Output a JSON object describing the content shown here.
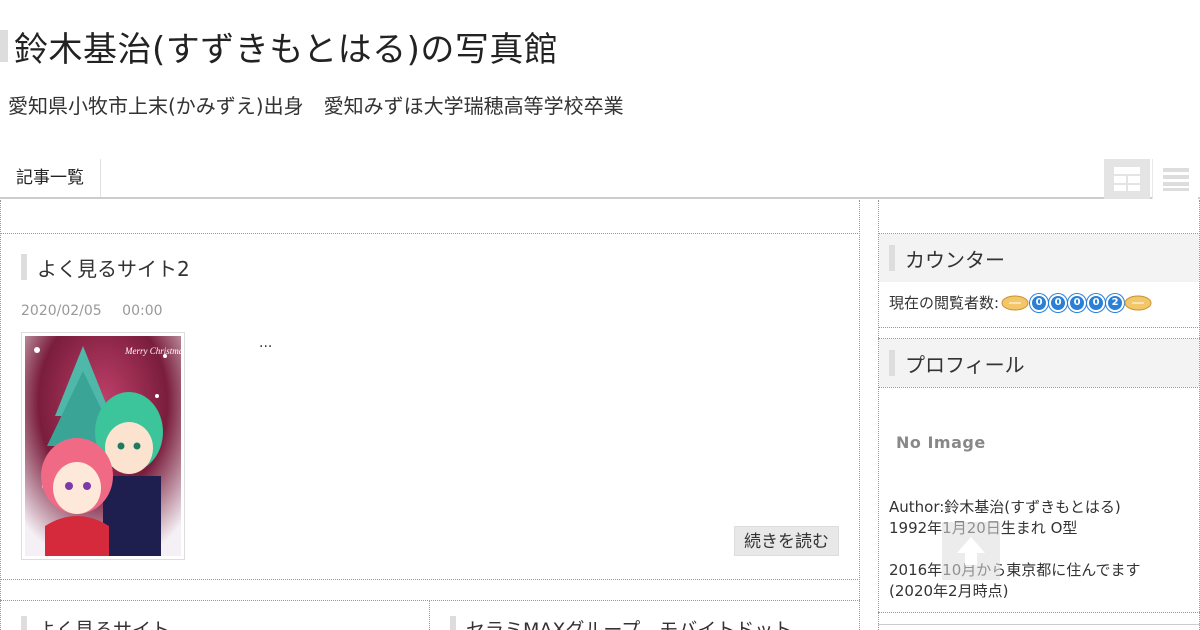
{
  "header": {
    "site_title": "鈴木基治(すずきもとはる)の写真館",
    "site_subtitle": "愛知県小牧市上末(かみずえ)出身　愛知みずほ大学瑞穂高等学校卒業"
  },
  "nav": {
    "items": [
      {
        "label": "記事一覧"
      }
    ],
    "view_grid_icon": "grid-view-icon",
    "view_list_icon": "list-view-icon"
  },
  "main": {
    "post": {
      "title": "よく見るサイト2",
      "date": "2020/02/05",
      "time": "00:00",
      "excerpt": "...",
      "thumbnail_caption": "Merry Christmas",
      "read_more": "続きを読む"
    },
    "next_posts": [
      {
        "title": "よく見るサイト"
      },
      {
        "title": "セラミMAXグループ　モバイトドット"
      }
    ]
  },
  "sidebar": {
    "counter": {
      "title": "カウンター",
      "label": "現在の閲覧者数:",
      "digits": [
        "0",
        "0",
        "0",
        "0",
        "2"
      ]
    },
    "profile": {
      "title": "プロフィール",
      "no_image": "No Image",
      "lines": [
        "Author:鈴木基治(すずきもとはる)",
        "1992年1月20日生まれ O型",
        "",
        "2016年10月から東京都に住んでます",
        "(2020年2月時点)"
      ]
    }
  },
  "scroll_top_icon": "arrow-up-icon",
  "colors": {
    "accent_bar": "#dddddd",
    "counter_blue": "#2a7fd6",
    "sidebar_head_bg": "#f3f3f3"
  }
}
